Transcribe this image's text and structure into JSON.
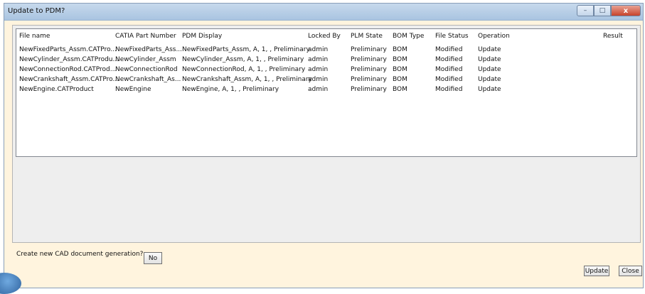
{
  "window": {
    "title": "Update to PDM?"
  },
  "caption": {
    "minimize": "–",
    "maximize": "□",
    "close": "x"
  },
  "table": {
    "columns": [
      "File name",
      "CATIA Part Number",
      "PDM Display",
      "Locked By",
      "PLM State",
      "BOM Type",
      "File Status",
      "Operation",
      "Result"
    ],
    "rows": [
      [
        "NewFixedParts_Assm.CATPro...",
        "NewFixedParts_Ass...",
        "NewFixedParts_Assm, A, 1, , Preliminary",
        "admin",
        "Preliminary",
        "BOM",
        "Modified",
        "Update",
        ""
      ],
      [
        "NewCylinder_Assm.CATProdu...",
        "NewCylinder_Assm",
        "NewCylinder_Assm, A, 1, , Preliminary",
        "admin",
        "Preliminary",
        "BOM",
        "Modified",
        "Update",
        ""
      ],
      [
        "NewConnectionRod.CATProd...",
        "NewConnectionRod",
        "NewConnectionRod, A, 1, , Preliminary",
        "admin",
        "Preliminary",
        "BOM",
        "Modified",
        "Update",
        ""
      ],
      [
        "NewCrankshaft_Assm.CATPro...",
        "NewCrankshaft_As...",
        "NewCrankshaft_Assm, A, 1, , Preliminary",
        "admin",
        "Preliminary",
        "BOM",
        "Modified",
        "Update",
        ""
      ],
      [
        "NewEngine.CATProduct",
        "NewEngine",
        "NewEngine, A, 1, , Preliminary",
        "admin",
        "Preliminary",
        "BOM",
        "Modified",
        "Update",
        ""
      ]
    ]
  },
  "footer": {
    "generation_label": "Create new CAD document generation?",
    "generation_value": "No",
    "update_label": "Update",
    "close_label": "Close"
  }
}
